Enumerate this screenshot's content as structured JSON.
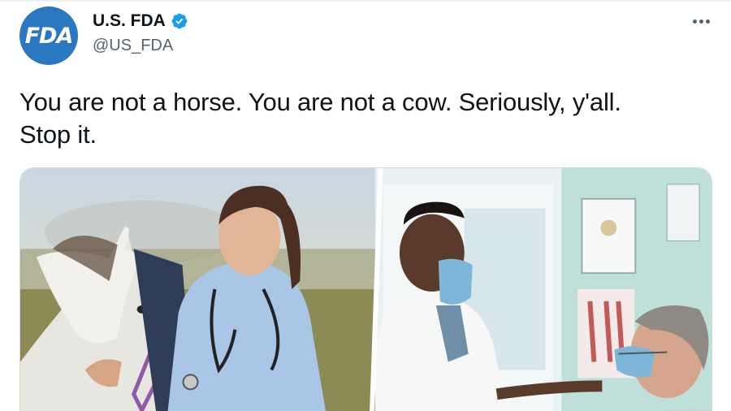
{
  "account": {
    "avatar_text": "FDA",
    "display_name": "U.S. FDA",
    "handle": "@US_FDA",
    "verified": true
  },
  "tweet": {
    "line1": "You are not a horse. You are not a cow. Seriously, y'all.",
    "line2": "Stop it."
  },
  "icons": {
    "verified": "verified-badge-icon",
    "more": "more-options-icon"
  },
  "colors": {
    "brand": "#2a78c2",
    "verified": "#1d9bf0",
    "text": "#0f1419",
    "secondary": "#536471"
  }
}
